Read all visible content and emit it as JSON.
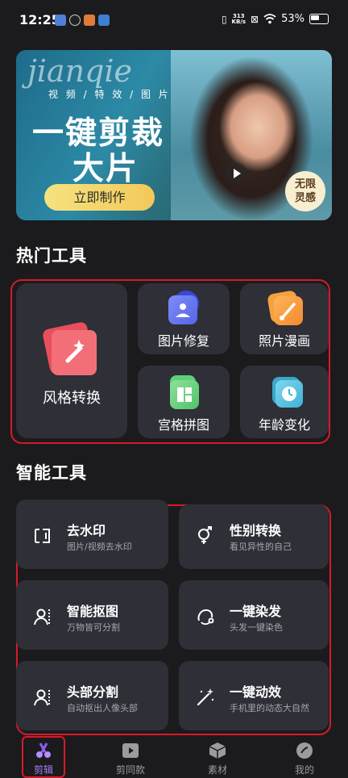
{
  "status_bar": {
    "time": "12:25",
    "net_speed_value": "313",
    "net_speed_unit": "KB/s",
    "battery": "53%"
  },
  "banner": {
    "script_text": "jianqie",
    "subtitle": "视 频 / 特 效 / 图 片",
    "title_line1": "一键剪裁",
    "title_line2": "大片",
    "cta_label": "立即制作",
    "badge_line1": "无限",
    "badge_line2": "灵感"
  },
  "hot_tools": {
    "title": "热门工具",
    "items": [
      {
        "label": "风格转换",
        "icon": "magic-wand-icon"
      },
      {
        "label": "图片修复",
        "icon": "image-icon"
      },
      {
        "label": "照片漫画",
        "icon": "paintbrush-icon"
      },
      {
        "label": "宫格拼图",
        "icon": "grid-icon"
      },
      {
        "label": "年龄变化",
        "icon": "clock-icon"
      }
    ]
  },
  "smart_tools": {
    "title": "智能工具",
    "items": [
      {
        "title": "去水印",
        "subtitle": "图片/视频去水印",
        "icon": "watermark-icon"
      },
      {
        "title": "性别转换",
        "subtitle": "看见异性的自己",
        "icon": "gender-icon"
      },
      {
        "title": "智能抠图",
        "subtitle": "万物皆可分割",
        "icon": "person-cutout-icon"
      },
      {
        "title": "一键染发",
        "subtitle": "头发一键染色",
        "icon": "hair-icon"
      },
      {
        "title": "头部分割",
        "subtitle": "自动抠出人像头部",
        "icon": "head-cutout-icon"
      },
      {
        "title": "一键动效",
        "subtitle": "手机里的动态大自然",
        "icon": "sparkle-wand-icon"
      }
    ]
  },
  "bottom_nav": {
    "items": [
      {
        "label": "剪辑",
        "active": true,
        "icon": "scissors-icon"
      },
      {
        "label": "剪同款",
        "active": false,
        "icon": "video-play-icon"
      },
      {
        "label": "素材",
        "active": false,
        "icon": "cube-icon"
      },
      {
        "label": "我的",
        "active": false,
        "icon": "profile-icon"
      }
    ]
  },
  "colors": {
    "accent": "#8e5cf0",
    "highlight_frame": "#d8192a",
    "card_bg": "#2e2f37"
  }
}
